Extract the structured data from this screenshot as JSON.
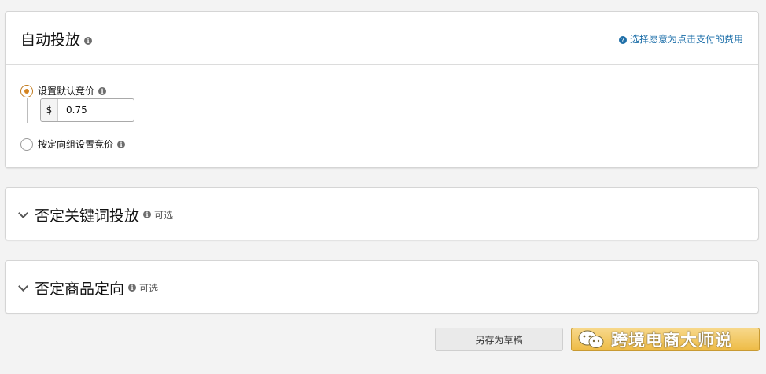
{
  "auto_targeting": {
    "title": "自动投放",
    "help_link": "选择愿意为点击支付的费用",
    "default_bid_option": {
      "label": "设置默认竞价",
      "selected": true,
      "currency": "$",
      "value": "0.75"
    },
    "group_bid_option": {
      "label": "按定向组设置竞价",
      "selected": false
    }
  },
  "negative_keywords": {
    "title": "否定关键词投放",
    "optional": "可选"
  },
  "negative_products": {
    "title": "否定商品定向",
    "optional": "可选"
  },
  "footer": {
    "save_draft": "另存为草稿",
    "watermark": "跨境电商大师说"
  },
  "colors": {
    "accent_orange": "#d58420",
    "link_blue": "#1a6da8",
    "button_yellow": "#eebb45"
  },
  "icons": {
    "info": "info-icon",
    "help": "help-circle-icon",
    "chevron": "chevron-down-icon",
    "watermark_logo": "wechat-icon"
  }
}
